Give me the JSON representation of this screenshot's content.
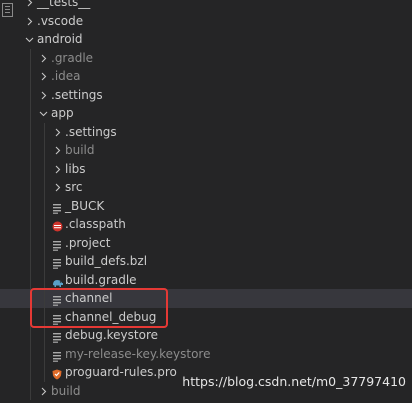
{
  "explorer": {
    "rows": [
      {
        "label": "__tests__",
        "kind": "folder",
        "depth": 1,
        "expanded": false
      },
      {
        "label": ".vscode",
        "kind": "folder",
        "depth": 1,
        "expanded": false
      },
      {
        "label": "android",
        "kind": "folder",
        "depth": 1,
        "expanded": true
      },
      {
        "label": ".gradle",
        "kind": "folder",
        "depth": 2,
        "expanded": false,
        "dim": true
      },
      {
        "label": ".idea",
        "kind": "folder",
        "depth": 2,
        "expanded": false,
        "dim": true
      },
      {
        "label": ".settings",
        "kind": "folder",
        "depth": 2,
        "expanded": false
      },
      {
        "label": "app",
        "kind": "folder",
        "depth": 2,
        "expanded": true
      },
      {
        "label": ".settings",
        "kind": "folder",
        "depth": 3,
        "expanded": false
      },
      {
        "label": "build",
        "kind": "folder",
        "depth": 3,
        "expanded": false,
        "dim": true
      },
      {
        "label": "libs",
        "kind": "folder",
        "depth": 3,
        "expanded": false
      },
      {
        "label": "src",
        "kind": "folder",
        "depth": 3,
        "expanded": false
      },
      {
        "label": "_BUCK",
        "kind": "file",
        "icon": "lines-file-icon",
        "depth": 3
      },
      {
        "label": ".classpath",
        "kind": "file",
        "icon": "eclipse-file-icon",
        "depth": 3
      },
      {
        "label": ".project",
        "kind": "file",
        "icon": "lines-file-icon",
        "depth": 3
      },
      {
        "label": "build_defs.bzl",
        "kind": "file",
        "icon": "lines-file-icon",
        "depth": 3
      },
      {
        "label": "build.gradle",
        "kind": "file",
        "icon": "gradle-elephant-icon",
        "depth": 3
      },
      {
        "label": "channel",
        "kind": "file",
        "icon": "lines-file-icon",
        "depth": 3,
        "selected": true
      },
      {
        "label": "channel_debug",
        "kind": "file",
        "icon": "lines-file-icon",
        "depth": 3
      },
      {
        "label": "debug.keystore",
        "kind": "file",
        "icon": "lines-file-icon",
        "depth": 3
      },
      {
        "label": "my-release-key.keystore",
        "kind": "file",
        "icon": "lines-file-icon",
        "depth": 3,
        "dim": true
      },
      {
        "label": "proguard-rules.pro",
        "kind": "file",
        "icon": "proguard-shield-icon",
        "depth": 3
      },
      {
        "label": "build",
        "kind": "folder",
        "depth": 2,
        "expanded": false,
        "dim": true
      }
    ]
  },
  "watermark": "https://blog.csdn.net/m0_37797410",
  "colors": {
    "background": "#252526",
    "selected_row": "#37373d",
    "text": "#cccccc",
    "dim_text": "#8c8c8c",
    "highlight_border": "#e53935"
  }
}
